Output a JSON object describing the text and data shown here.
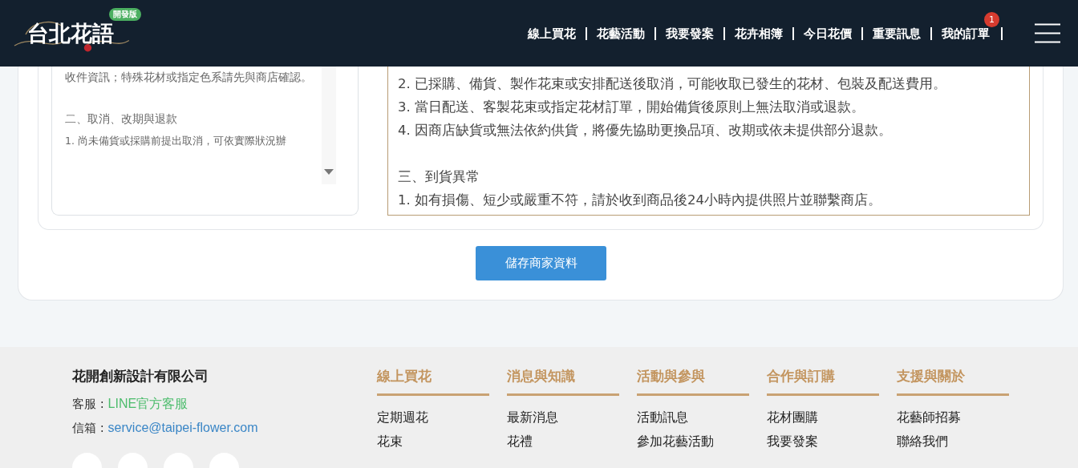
{
  "header": {
    "logo": {
      "text": "台北花語",
      "badge": "開發版"
    },
    "nav": [
      {
        "label": "線上買花"
      },
      {
        "label": "花藝活動"
      },
      {
        "label": "我要發案"
      },
      {
        "label": "花卉相簿"
      },
      {
        "label": "今日花價"
      },
      {
        "label": "重要訊息"
      },
      {
        "label": "我的訂單",
        "badge": "1"
      }
    ]
  },
  "policy": {
    "left_box": [
      [
        "收件資訊；特殊花材或指定色系請先與商店確認。"
      ],
      [
        "二、取消、改期與退款",
        "1. 尚未備貨或採購前提出取消，可依實際狀況辦"
      ]
    ],
    "right_box": [
      [
        "2. 已採購、備貨、製作花束或安排配送後取消，可能收取已發生的花材、包裝及配送費用。",
        "3. 當日配送、客製花束或指定花材訂單，開始備貨後原則上無法取消或退款。",
        "4. 因商店缺貨或無法依約供貨，將優先協助更換品項、改期或依未提供部分退款。"
      ],
      [
        "三、到貨異常",
        "1. 如有損傷、短少或嚴重不符，請於收到商品後24小時內提供照片並聯繫商店。"
      ]
    ]
  },
  "save_button": "儲存商家資料",
  "footer": {
    "company": "花開創新設計有限公司",
    "contacts": [
      {
        "label": "客服 : ",
        "value": "LINE官方客服",
        "kind": "line"
      },
      {
        "label": "信箱 : ",
        "value": "service@taipei-flower.com",
        "kind": "email"
      }
    ],
    "columns": [
      {
        "title": "線上買花",
        "links": [
          "定期週花",
          "花束"
        ]
      },
      {
        "title": "消息與知識",
        "links": [
          "最新消息",
          "花禮"
        ]
      },
      {
        "title": "活動與參與",
        "links": [
          "活動訊息",
          "參加花藝活動"
        ]
      },
      {
        "title": "合作與訂購",
        "links": [
          "花材團購",
          "我要發案"
        ]
      },
      {
        "title": "支援與關於",
        "links": [
          "花藝師招募",
          "聯絡我們"
        ]
      }
    ]
  }
}
